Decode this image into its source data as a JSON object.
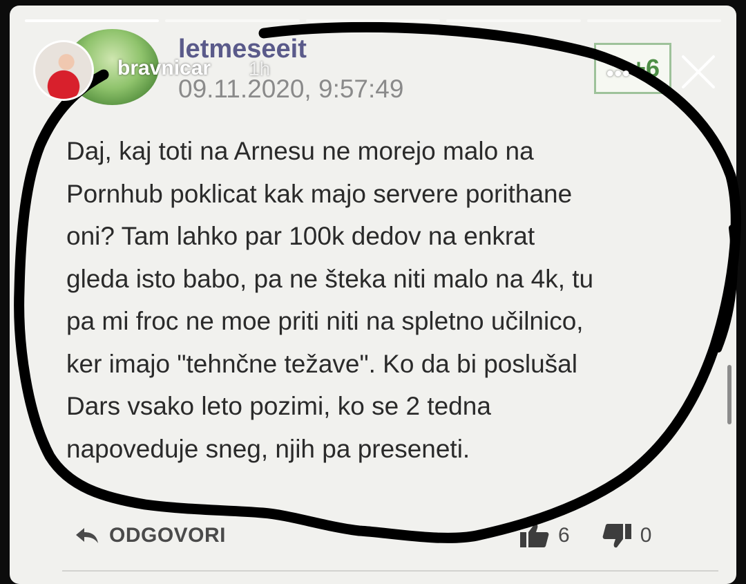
{
  "story": {
    "username": "bravnicar",
    "time_ago": "1h",
    "more_label": "•••",
    "progress_segments": 5,
    "progress_done": 1
  },
  "comment": {
    "author": "letmeseeit",
    "date": "09.11.2020, 9:57:49",
    "score": "+6",
    "body_lines": [
      "Daj, kaj toti na Arnesu ne morejo malo na",
      "Pornhub poklicat kak majo servere porithane",
      "oni? Tam lahko par 100k dedov na enkrat",
      "gleda isto babo, pa ne šteka niti malo na 4k, tu",
      "pa mi froc ne moe priti niti na spletno učilnico,",
      "ker imajo \"tehnčne težave\". Ko da bi poslušal",
      "Dars vsako leto pozimi, ko se 2 tedna",
      "napoveduje sneg, njih pa preseneti."
    ],
    "reply_label": "ODGOVORI",
    "upvotes": "6",
    "downvotes": "0"
  },
  "icons": {
    "reply": "reply-arrow-icon",
    "upvote": "thumbs-up-icon",
    "downvote": "thumbs-down-icon",
    "close": "close-icon"
  },
  "colors": {
    "card_background": "#f1f1ee",
    "author": "#5a5a8a",
    "score_green": "#4f8f47",
    "scribble": "#000000"
  }
}
